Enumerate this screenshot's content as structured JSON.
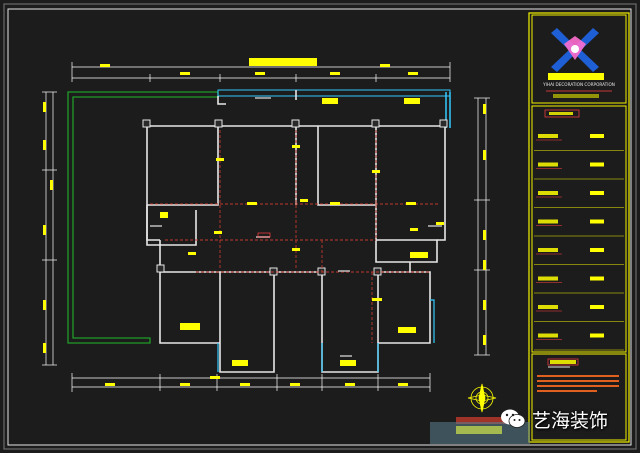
{
  "colors": {
    "background": "#1c1c1c",
    "dimension_line": "#ffffff",
    "wall": "#e6e6e6",
    "tag_yellow": "#ffff00",
    "grid_red": "#c0392b",
    "outer_green": "#1f9c2a",
    "window_cyan": "#33c9ff",
    "titleblock_border": "#f2f200",
    "logo_blue": "#1f5fd6",
    "logo_pink": "#ff6fd0"
  },
  "titleblock": {
    "company_en": "YIHAI DECORATION CORPORATION",
    "rows": [
      {
        "icon": "label-block"
      },
      {
        "icon": "label-block"
      },
      {
        "icon": "label-block"
      },
      {
        "icon": "label-block"
      },
      {
        "icon": "label-block"
      },
      {
        "icon": "label-block"
      },
      {
        "icon": "label-block"
      },
      {
        "icon": "label-block"
      }
    ]
  },
  "drawing": {
    "room_tags": [
      {
        "id": "r1"
      },
      {
        "id": "r2"
      },
      {
        "id": "r3"
      },
      {
        "id": "r4"
      },
      {
        "id": "r5"
      },
      {
        "id": "r6"
      },
      {
        "id": "r7"
      },
      {
        "id": "r8"
      }
    ]
  },
  "watermark": {
    "text": "艺海装饰",
    "icon": "wechat-icon"
  }
}
